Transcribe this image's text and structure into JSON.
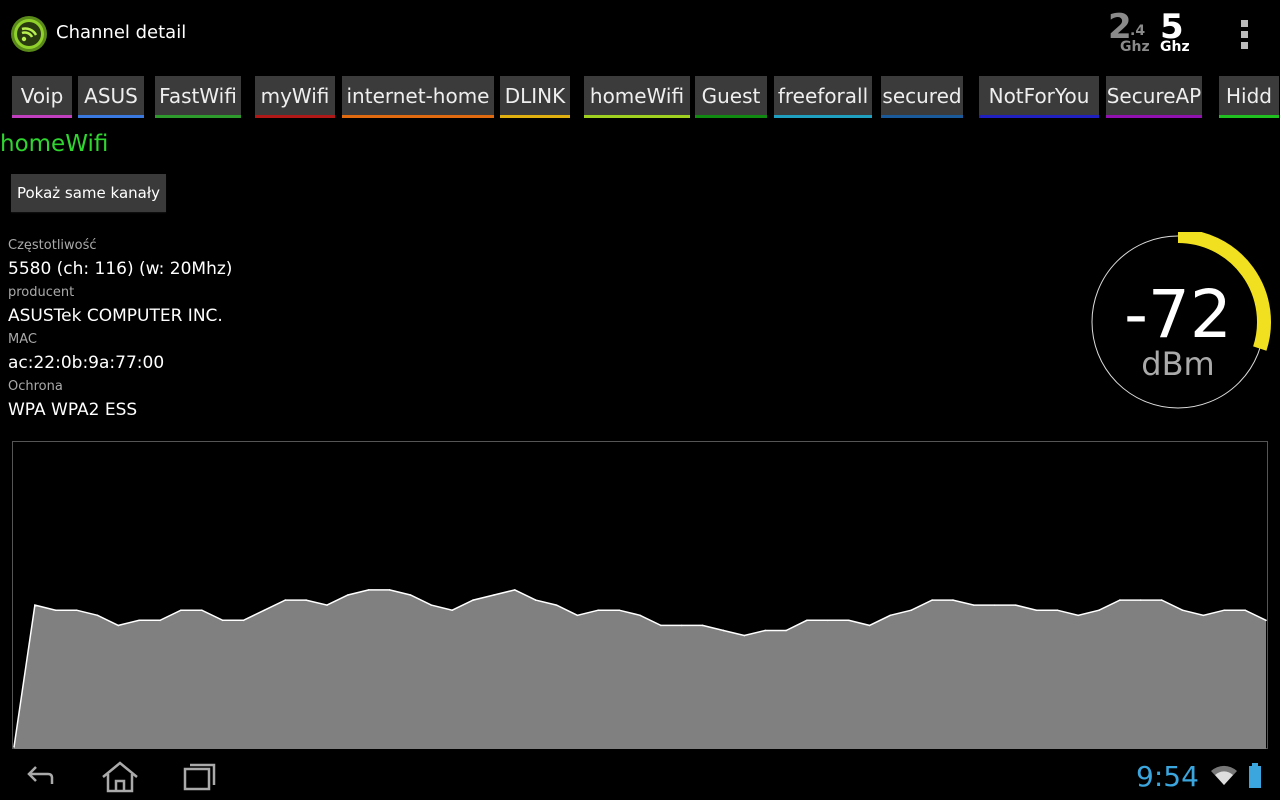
{
  "app": {
    "title": "Channel detail",
    "icon": "wifi-app-icon",
    "bands": {
      "band_24": {
        "num": "2",
        "sub": ".4",
        "unit": "Ghz"
      },
      "band_5": {
        "num": "5",
        "unit": "Ghz"
      }
    },
    "accent": "#2fd62f"
  },
  "tabs": [
    {
      "label": "Voip",
      "color": "#c040c0"
    },
    {
      "label": "ASUS",
      "color": "#3a7ae0"
    },
    {
      "label": "FastWifi",
      "color": "#2e9a2e"
    },
    {
      "label": "myWifi",
      "color": "#b01818"
    },
    {
      "label": "internet-home",
      "color": "#e06a10"
    },
    {
      "label": "DLINK",
      "color": "#e0b010"
    },
    {
      "label": "homeWifi",
      "color": "#a0d020"
    },
    {
      "label": "Guest",
      "color": "#108a10"
    },
    {
      "label": "freeforall",
      "color": "#20a0c0"
    },
    {
      "label": "secured",
      "color": "#1a5a9a"
    },
    {
      "label": "NotForYou",
      "color": "#2020c0"
    },
    {
      "label": "SecureAP",
      "color": "#9010b0"
    },
    {
      "label": "Hidd",
      "color": "#20c020"
    }
  ],
  "network": {
    "name": "homeWifi",
    "show_button": "Pokaż same kanały",
    "fields": [
      {
        "label": "Częstotliwość",
        "value": "5580 (ch: 116) (w: 20Mhz)"
      },
      {
        "label": "producent",
        "value": "ASUSTek COMPUTER INC."
      },
      {
        "label": "MAC",
        "value": "ac:22:0b:9a:77:00"
      },
      {
        "label": "Ochrona",
        "value": "WPA WPA2 ESS"
      }
    ]
  },
  "gauge": {
    "value": "-72",
    "unit": "dBm",
    "arc_color": "#f0e020",
    "fill_fraction": 0.3
  },
  "chart_data": {
    "type": "area",
    "values": [
      -100,
      -72,
      -73,
      -73,
      -74,
      -76,
      -75,
      -75,
      -73,
      -73,
      -75,
      -75,
      -73,
      -71,
      -71,
      -72,
      -70,
      -69,
      -69,
      -70,
      -72,
      -73,
      -71,
      -70,
      -69,
      -71,
      -72,
      -74,
      -73,
      -73,
      -74,
      -76,
      -76,
      -76,
      -77,
      -78,
      -77,
      -77,
      -75,
      -75,
      -75,
      -76,
      -74,
      -73,
      -71,
      -71,
      -72,
      -72,
      -72,
      -73,
      -73,
      -74,
      -73,
      -71,
      -71,
      -71,
      -73,
      -74,
      -73,
      -73,
      -75
    ],
    "ylim": [
      -100,
      -40
    ],
    "grid": false,
    "fill_color": "#808080",
    "line_color": "#ffffff"
  },
  "statusbar": {
    "time": "9:54",
    "time_color": "#3aa6dd"
  }
}
